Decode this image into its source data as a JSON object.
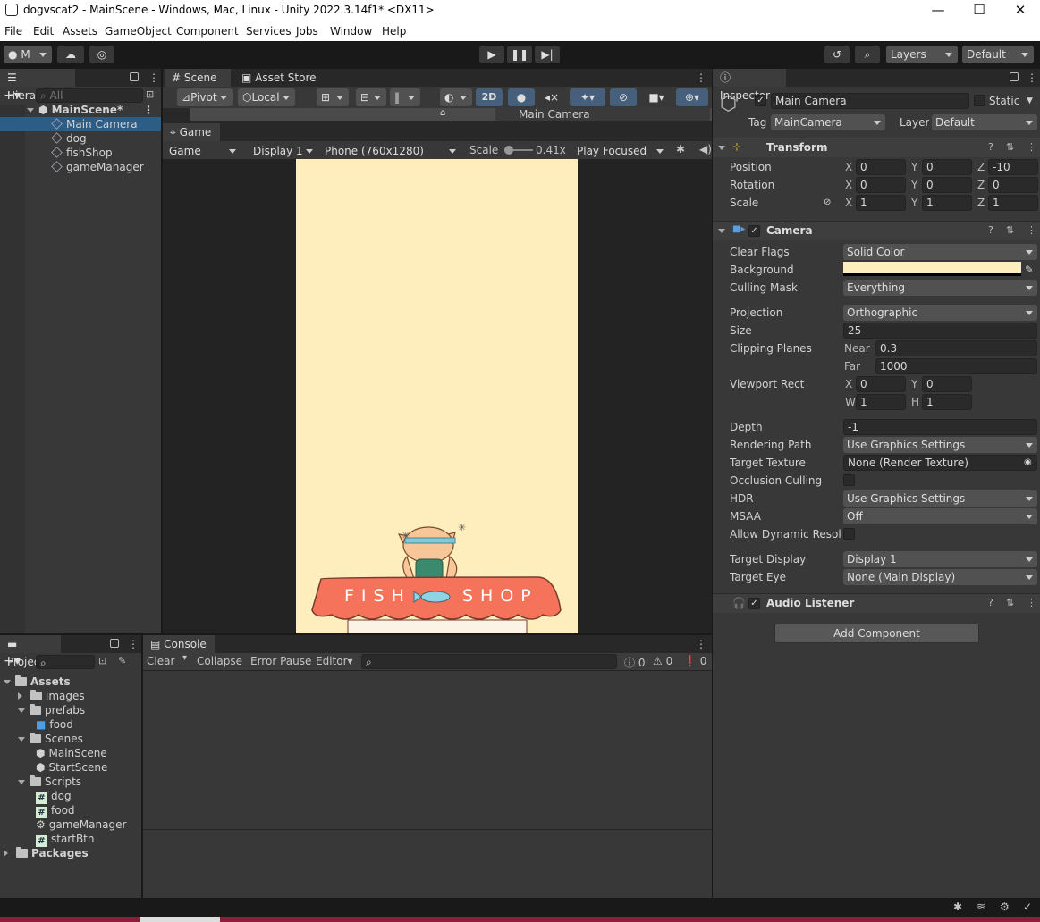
{
  "window": {
    "title": "dogvscat2 - MainScene - Windows, Mac, Linux - Unity 2022.3.14f1* <DX11>",
    "min": "—",
    "max": "☐",
    "close": "✕"
  },
  "menu": [
    "File",
    "Edit",
    "Assets",
    "GameObject",
    "Component",
    "Services",
    "Jobs",
    "Window",
    "Help"
  ],
  "toolbar": {
    "account": "M",
    "layers": "Layers",
    "layout": "Default"
  },
  "hierarchy": {
    "title": "Hierarchy",
    "search_placeholder": "All",
    "scene": "MainScene*",
    "items": [
      "Main Camera",
      "dog",
      "fishShop",
      "gameManager"
    ]
  },
  "scene_tabs": {
    "scene": "Scene",
    "asset_store": "Asset Store",
    "game": "Game"
  },
  "scene_toolbar": {
    "pivot": "Pivot",
    "local": "Local",
    "mode2d": "2D",
    "overlay_label": "Main Camera"
  },
  "game_toolbar": {
    "view": "Game",
    "display": "Display 1",
    "resolution": "Phone (760x1280)",
    "scale_label": "Scale",
    "scale_value": "0.41x",
    "play_mode": "Play Focused"
  },
  "game_view": {
    "bg": "#ffeebd",
    "awning_left": "FISH",
    "awning_right": "SHOP"
  },
  "project": {
    "title": "Project",
    "tree": [
      {
        "label": "Assets",
        "kind": "folder",
        "depth": 0,
        "open": true,
        "bold": true
      },
      {
        "label": "images",
        "kind": "folder",
        "depth": 1,
        "open": false
      },
      {
        "label": "prefabs",
        "kind": "folder",
        "depth": 1,
        "open": true
      },
      {
        "label": "food",
        "kind": "prefab",
        "depth": 2
      },
      {
        "label": "Scenes",
        "kind": "folder",
        "depth": 1,
        "open": true
      },
      {
        "label": "MainScene",
        "kind": "scene",
        "depth": 2
      },
      {
        "label": "StartScene",
        "kind": "scene",
        "depth": 2
      },
      {
        "label": "Scripts",
        "kind": "folder",
        "depth": 1,
        "open": true
      },
      {
        "label": "dog",
        "kind": "script",
        "depth": 2
      },
      {
        "label": "food",
        "kind": "script",
        "depth": 2
      },
      {
        "label": "gameManager",
        "kind": "gear",
        "depth": 2
      },
      {
        "label": "startBtn",
        "kind": "script",
        "depth": 2
      },
      {
        "label": "Packages",
        "kind": "folder",
        "depth": 0,
        "open": false,
        "bold": true
      }
    ]
  },
  "console": {
    "title": "Console",
    "clear": "Clear",
    "collapse": "Collapse",
    "error_pause": "Error Pause",
    "editor": "Editor",
    "count_info": "0",
    "count_warn": "0",
    "count_err": "0"
  },
  "inspector": {
    "title": "Inspector",
    "object_name": "Main Camera",
    "static": "Static",
    "tag_label": "Tag",
    "tag": "MainCamera",
    "layer_label": "Layer",
    "layer": "Default",
    "transform": {
      "title": "Transform",
      "position": [
        "0",
        "0",
        "-10"
      ],
      "rotation": [
        "0",
        "0",
        "0"
      ],
      "scale": [
        "1",
        "1",
        "1"
      ],
      "l_position": "Position",
      "l_rotation": "Rotation",
      "l_scale": "Scale"
    },
    "camera": {
      "title": "Camera",
      "clear_flags": "Solid Color",
      "background_color": "#ffeebd",
      "culling_mask": "Everything",
      "projection": "Orthographic",
      "size": "25",
      "near": "0.3",
      "far": "1000",
      "vp_x": "0",
      "vp_y": "0",
      "vp_w": "1",
      "vp_h": "1",
      "depth": "-1",
      "rendering_path": "Use Graphics Settings",
      "target_texture": "None (Render Texture)",
      "hdr": "Use Graphics Settings",
      "msaa": "Off",
      "target_display": "Display 1",
      "target_eye": "None (Main Display)",
      "labels": {
        "clear_flags": "Clear Flags",
        "background": "Background",
        "culling_mask": "Culling Mask",
        "projection": "Projection",
        "size": "Size",
        "clipping": "Clipping Planes",
        "near": "Near",
        "far": "Far",
        "viewport": "Viewport Rect",
        "depth": "Depth",
        "rendering_path": "Rendering Path",
        "target_texture": "Target Texture",
        "occlusion": "Occlusion Culling",
        "hdr": "HDR",
        "msaa": "MSAA",
        "dyn_res": "Allow Dynamic Resolu",
        "target_display": "Target Display",
        "target_eye": "Target Eye"
      }
    },
    "audio": {
      "title": "Audio Listener"
    },
    "add_component": "Add Component"
  }
}
